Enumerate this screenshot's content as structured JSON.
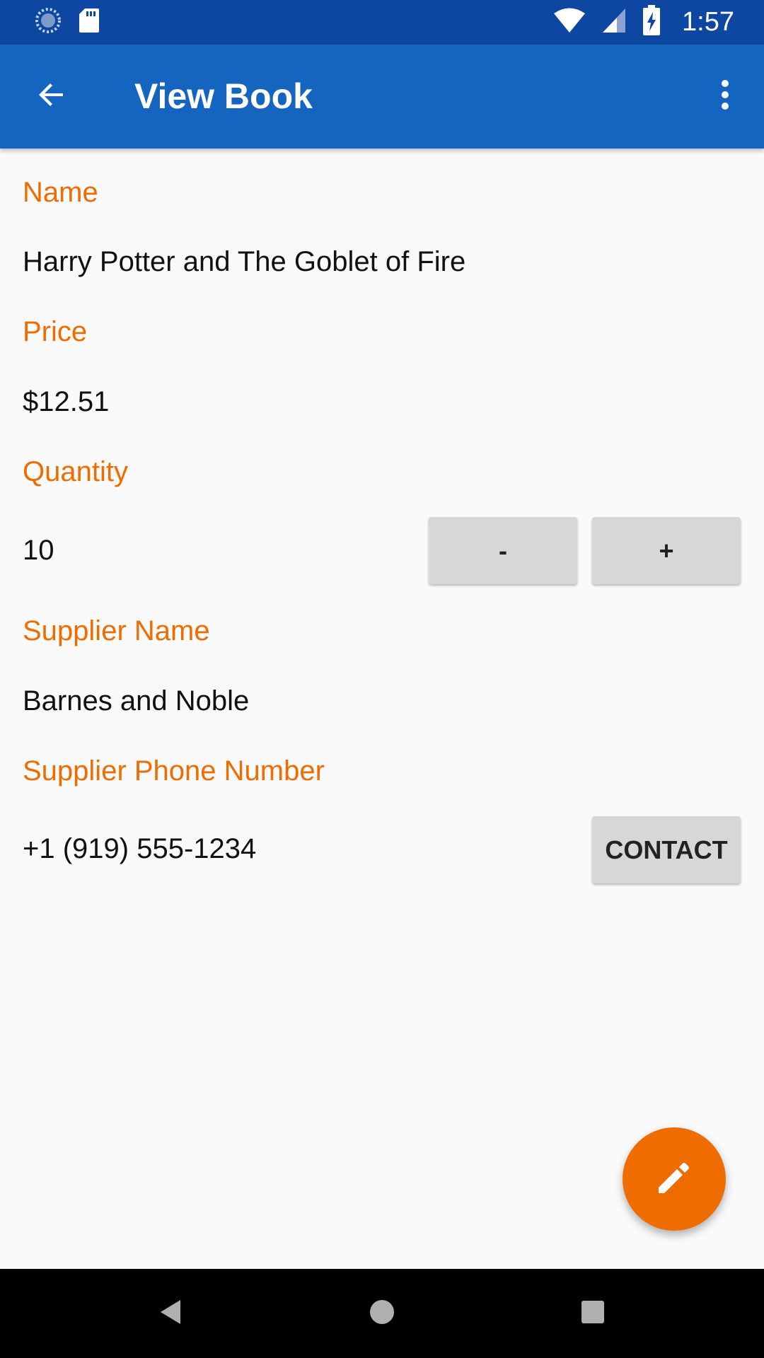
{
  "status_bar": {
    "time": "1:57",
    "icons": [
      "sync-icon",
      "sd-card-icon",
      "wifi-icon",
      "signal-icon",
      "battery-charging-icon"
    ]
  },
  "app_bar": {
    "title": "View Book",
    "back_icon": "arrow-back-icon",
    "menu_icon": "more-vert-icon"
  },
  "fields": {
    "name_label": "Name",
    "name_value": "Harry Potter and The Goblet of Fire",
    "price_label": "Price",
    "price_value": "$12.51",
    "quantity_label": "Quantity",
    "quantity_value": "10",
    "supplier_name_label": "Supplier Name",
    "supplier_name_value": "Barnes and Noble",
    "supplier_phone_label": "Supplier Phone Number",
    "supplier_phone_value": "+1 (919) 555-1234"
  },
  "buttons": {
    "decrement_label": "-",
    "increment_label": "+",
    "contact_label": "CONTACT"
  },
  "fab": {
    "icon": "edit-pencil-icon"
  },
  "nav_bar": {
    "icons": [
      "nav-back-icon",
      "nav-home-icon",
      "nav-recents-icon"
    ]
  },
  "colors": {
    "status_bar": "#0d47a1",
    "app_bar": "#1565c0",
    "accent": "#ef6c00",
    "button": "#d6d7d7"
  }
}
